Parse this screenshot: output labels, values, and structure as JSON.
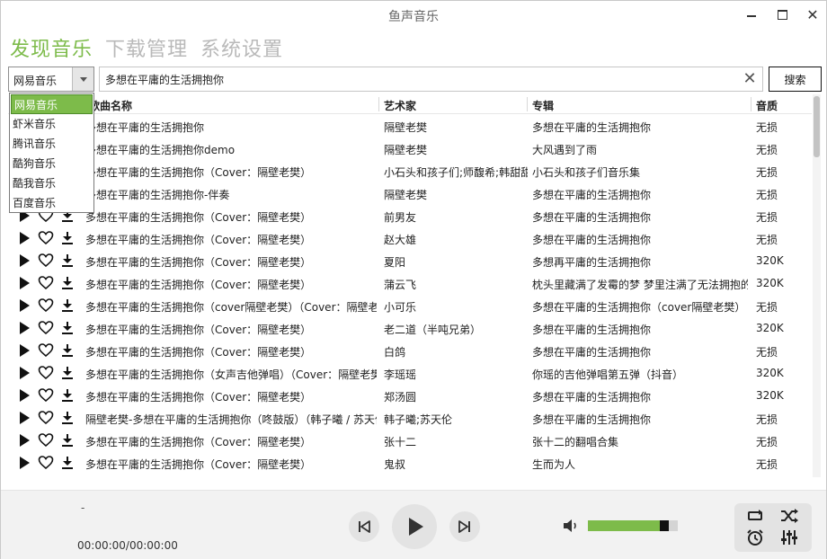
{
  "window": {
    "title": "鱼声音乐"
  },
  "tabs": [
    {
      "label": "发现音乐",
      "active": true
    },
    {
      "label": "下载管理",
      "active": false
    },
    {
      "label": "系统设置",
      "active": false
    }
  ],
  "search": {
    "source_selected": "网易音乐",
    "query": "多想在平庸的生活拥抱你",
    "button_label": "搜索"
  },
  "sources_dropdown": [
    "网易音乐",
    "虾米音乐",
    "腾讯音乐",
    "酷狗音乐",
    "酷我音乐",
    "百度音乐"
  ],
  "table": {
    "headers": {
      "title": "歌曲名称",
      "artist": "艺术家",
      "album": "专辑",
      "quality": "音质"
    },
    "rows": [
      {
        "title": "多想在平庸的生活拥抱你",
        "artist": "隔壁老樊",
        "album": "多想在平庸的生活拥抱你",
        "quality": "无损"
      },
      {
        "title": "多想在平庸的生活拥抱你demo",
        "artist": "隔壁老樊",
        "album": "大风遇到了雨",
        "quality": "无损"
      },
      {
        "title": "多想在平庸的生活拥抱你（Cover：隔壁老樊）",
        "artist": "小石头和孩子们;师馥希;韩甜甜",
        "album": "小石头和孩子们音乐集",
        "quality": "无损"
      },
      {
        "title": "多想在平庸的生活拥抱你-伴奏",
        "artist": "隔壁老樊",
        "album": "多想在平庸的生活拥抱你",
        "quality": "无损"
      },
      {
        "title": "多想在平庸的生活拥抱你（Cover：隔壁老樊）",
        "artist": "前男友",
        "album": "多想在平庸的生活拥抱你",
        "quality": "无损"
      },
      {
        "title": "多想在平庸的生活拥抱你（Cover：隔壁老樊）",
        "artist": "赵大雄",
        "album": "多想在平庸的生活拥抱你",
        "quality": "无损"
      },
      {
        "title": "多想在平庸的生活拥抱你（Cover：隔壁老樊）",
        "artist": "夏阳",
        "album": "多想再平庸的生活拥抱你",
        "quality": "320K"
      },
      {
        "title": "多想在平庸的生活拥抱你（Cover：隔壁老樊）",
        "artist": "蒲云飞",
        "album": "枕头里藏满了发霉的梦 梦里注满了无法拥抱的你",
        "quality": "320K"
      },
      {
        "title": "多想在平庸的生活拥抱你（cover隔壁老樊）（Cover：隔壁老樊）",
        "artist": "小可乐",
        "album": "多想在平庸的生活拥抱你（cover隔壁老樊）",
        "quality": "无损"
      },
      {
        "title": "多想在平庸的生活拥抱你（Cover：隔壁老樊）",
        "artist": "老二道（半吨兄弟）",
        "album": "多想在平庸的生活拥抱你",
        "quality": "320K"
      },
      {
        "title": "多想在平庸的生活拥抱你（Cover：隔壁老樊）",
        "artist": "白鸽",
        "album": "多想在平庸的生活拥抱你",
        "quality": "无损"
      },
      {
        "title": "多想在平庸的生活拥抱你（女声吉他弹唱）（Cover：隔壁老樊）",
        "artist": "李瑶瑶",
        "album": "你瑶的吉他弹唱第五弹（抖音）",
        "quality": "320K"
      },
      {
        "title": "多想在平庸的生活拥抱你（Cover：隔壁老樊）",
        "artist": "郑汤圆",
        "album": "多想在平庸的生活拥抱你",
        "quality": "320K"
      },
      {
        "title": "隔壁老樊-多想在平庸的生活拥抱你（咚鼓版）（韩子曦 / 苏天伦）",
        "artist": "韩子曦;苏天伦",
        "album": "多想在平庸的生活拥抱你",
        "quality": "无损"
      },
      {
        "title": "多想在平庸的生活拥抱你（Cover：隔壁老樊）",
        "artist": "张十二",
        "album": "张十二的翻唱合集",
        "quality": "无损"
      },
      {
        "title": "多想在平庸的生活拥抱你（Cover：隔壁老樊）",
        "artist": "鬼叔",
        "album": "生而为人",
        "quality": "无损"
      }
    ]
  },
  "player": {
    "now_playing": "-",
    "time": "00:00:00/00:00:00",
    "volume_fraction": 0.8
  },
  "colors": {
    "accent": "#7dbb4a"
  },
  "icons": [
    "play-icon",
    "heart-icon",
    "download-icon",
    "previous-icon",
    "next-icon",
    "volume-icon",
    "repeat-icon",
    "shuffle-icon",
    "alarm-icon",
    "equalizer-icon"
  ]
}
